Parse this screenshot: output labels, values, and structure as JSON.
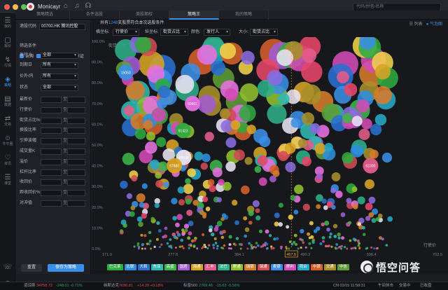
{
  "app": {
    "name": "Monicayr",
    "search_placeholder": "代码/拼音/名称"
  },
  "tabs": [
    {
      "label": "策略精选"
    },
    {
      "label": "条件选股"
    },
    {
      "label": "美股期权"
    },
    {
      "label": "策略王"
    },
    {
      "label": "我的策略"
    }
  ],
  "rail": [
    {
      "icon": "☰",
      "label": "我的"
    },
    {
      "icon": "▢",
      "label": "报价"
    },
    {
      "icon": "↯",
      "label": "行情"
    },
    {
      "icon": "◈",
      "label": "策略"
    },
    {
      "icon": "▤",
      "label": "数据"
    },
    {
      "icon": "⇄",
      "label": "交易"
    },
    {
      "icon": "☺",
      "label": "牛牛圈"
    },
    {
      "icon": "♡",
      "label": "资讯"
    },
    {
      "icon": "☰",
      "label": "课堂"
    }
  ],
  "filter": {
    "code_label": "港股代码",
    "code_value": "00700.HK 腾讯控股",
    "checks": [
      "认购",
      "认沽",
      "牛证",
      "熊证"
    ],
    "section": "筛选条件",
    "issuer_label": "发行人",
    "issuer_value": "全部",
    "expiry_label": "到期日",
    "expiry_value": "所有",
    "moneyness_label": "价外/内",
    "moneyness_value": "所有",
    "status_label": "状态",
    "status_value": "全部",
    "range_fields": [
      "最新价",
      "行使价",
      "街货占比%",
      "换股比率",
      "引伸波幅",
      "成交量K",
      "溢价",
      "杠杆比率",
      "收回价",
      "距收回价%",
      "对冲值"
    ],
    "range_to": "至",
    "reset_label": "重置",
    "save_label": "保存为策略"
  },
  "main": {
    "summary_prefix": "共有",
    "summary_count": "1248",
    "summary_suffix": "支股票符合本次选股条件",
    "view_list": "列表",
    "view_bubble": "气泡图",
    "x_label": "横坐标:",
    "x_value": "行使价",
    "y_label": "纵坐标:",
    "y_value": "街货占比",
    "color_label": "颜色:",
    "color_value": "发行人",
    "size_label": "大小:",
    "size_value": "街货占比"
  },
  "chart_data": {
    "type": "scatter",
    "ylabel": "街货占比",
    "xlabel": "行使价",
    "x_ticks": [
      "171.9",
      "277.8",
      "384.1",
      "490.3",
      "596.4",
      "702.5"
    ],
    "y_ticks": [
      "100.0%",
      "90.0%",
      "80.0%",
      "70.0%",
      "60.0%",
      "50.0%",
      "40.0%",
      "30.0%",
      "20.0%",
      "10.0%",
      "0.0%"
    ],
    "xlim": [
      171.9,
      702.5
    ],
    "ylim": [
      0,
      100
    ],
    "highlight_x": "467.8",
    "labeled_points": [
      {
        "label": "15063",
        "x": 202,
        "y": 85
      },
      {
        "label": "60801",
        "x": 309,
        "y": 70
      },
      {
        "label": "61423",
        "x": 294,
        "y": 57
      },
      {
        "label": "68606",
        "x": 295,
        "y": 44
      },
      {
        "label": "67880",
        "x": 280,
        "y": 40
      },
      {
        "label": "62300",
        "x": 595,
        "y": 40
      }
    ],
    "issuers": [
      {
        "name": "巴克莱",
        "color": "#2eaa3f"
      },
      {
        "name": "比联",
        "color": "#2f8ee0"
      },
      {
        "name": "大和",
        "color": "#2a6fd0"
      },
      {
        "name": "东亚",
        "color": "#2fb8b0"
      },
      {
        "name": "高盛",
        "color": "#3cb54a"
      },
      {
        "name": "国君",
        "color": "#a25bd1"
      },
      {
        "name": "海通",
        "color": "#d8a325"
      },
      {
        "name": "汇丰",
        "color": "#e55c8b"
      },
      {
        "name": "法巴",
        "color": "#2fae86"
      },
      {
        "name": "摩通",
        "color": "#8fbf2e"
      },
      {
        "name": "瑞银",
        "color": "#d77c2a"
      },
      {
        "name": "瑞通",
        "color": "#cf4b53"
      },
      {
        "name": "麦银",
        "color": "#3a8ee6"
      },
      {
        "name": "摩利",
        "color": "#d44ab6"
      },
      {
        "name": "荷合",
        "color": "#28a7c7"
      },
      {
        "name": "中银",
        "color": "#d55f2a"
      },
      {
        "name": "交通",
        "color": "#a88e2a"
      },
      {
        "name": "中信",
        "color": "#5f9e36"
      }
    ]
  },
  "status": {
    "hsi_label": "道琼斯",
    "hsi_value": "34758.72",
    "hsi_change": "-248.01 -0.71%",
    "nasdaq_label": "纳斯达克",
    "nasdaq_value": "7696.81",
    "nasdaq_change": "+14.20 +0.18%",
    "sp_label": "标普500",
    "sp_value": "2769.46",
    "sp_change": "-15.63 -0.56%",
    "clock": "CN 03/15 11:58:31",
    "market_state": "午间休市",
    "trade_state": "交易中",
    "other_state": "已收盘"
  },
  "watermark": {
    "text": "悟空问答"
  }
}
